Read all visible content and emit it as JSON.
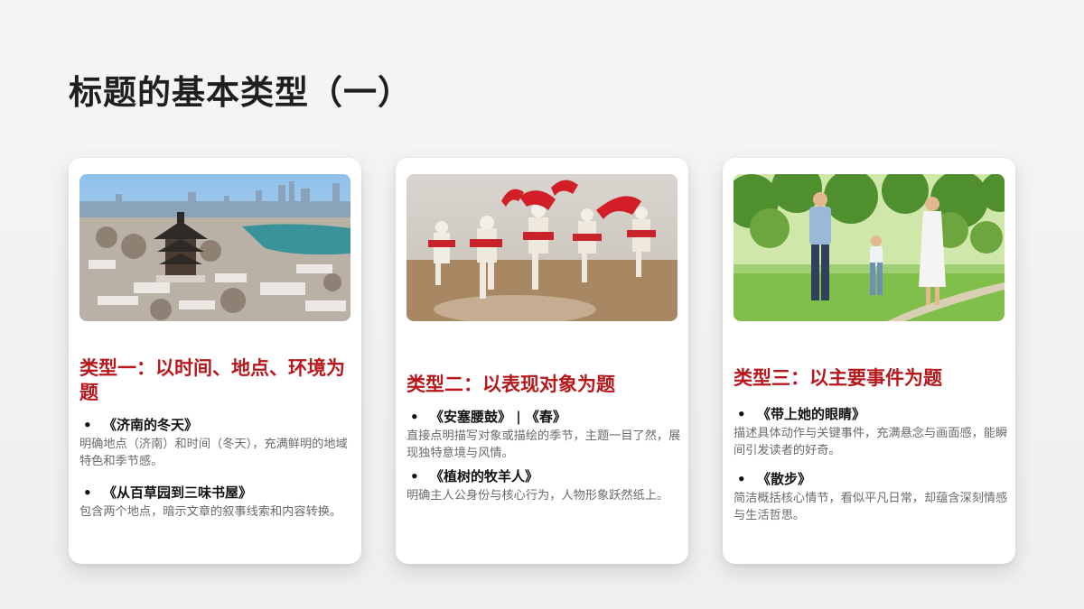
{
  "page": {
    "title": "标题的基本类型（一）"
  },
  "cards": [
    {
      "heading": "类型一：以时间、地点、环境为题",
      "image": "city-snow-pavilion-photo",
      "items": [
        {
          "bullet": "•",
          "title": "《济南的冬天》",
          "desc": "明确地点（济南）和时间（冬天），充满鲜明的地域特色和季节感。"
        },
        {
          "bullet": "•",
          "title": "《从百草园到三味书屋》",
          "desc": "包含两个地点，暗示文章的叙事线索和内容转换。"
        }
      ]
    },
    {
      "heading": "类型二：以表现对象为题",
      "image": "waist-drum-dancers-photo",
      "items": [
        {
          "bullet": "•",
          "title": "《安塞腰鼓》 | 《春》",
          "desc": "直接点明描写对象或描绘的季节，主题一目了然，展现独特意境与风情。"
        },
        {
          "bullet": "•",
          "title": "《植树的牧羊人》",
          "desc": "明确主人公身份与核心行为，人物形象跃然纸上。"
        }
      ]
    },
    {
      "heading": "类型三：以主要事件为题",
      "image": "family-walk-park-photo",
      "items": [
        {
          "bullet": "•",
          "title": "《带上她的眼睛》",
          "desc": "描述具体动作与关键事件，充满悬念与画面感，能瞬间引发读者的好奇。"
        },
        {
          "bullet": "•",
          "title": "《散步》",
          "desc": "简洁概括核心情节，看似平凡日常，却蕴含深刻情感与生活哲思。"
        }
      ]
    }
  ],
  "colors": {
    "accent": "#b8171c",
    "title": "#1f1f1f",
    "body_text": "#6b6b6b"
  }
}
